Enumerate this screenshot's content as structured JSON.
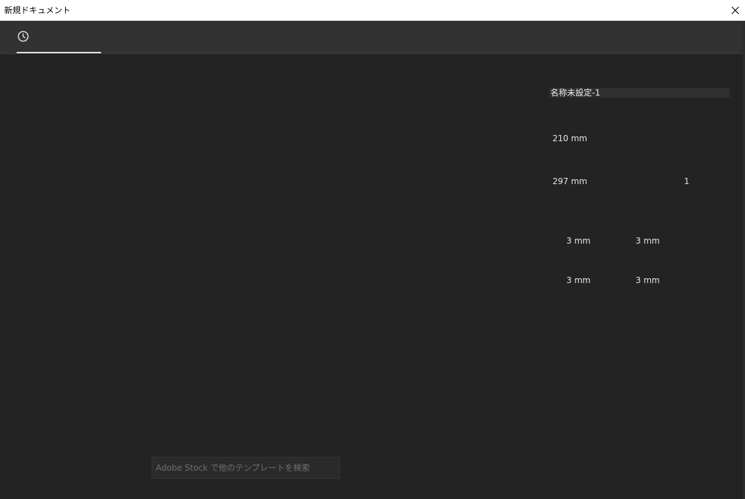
{
  "window": {
    "title": "新規ドキュメント",
    "close_icon": "close-icon"
  },
  "tabs": {
    "recent_icon": "clock-icon",
    "active": "recent"
  },
  "preset": {
    "document_name": "名称未設定-1",
    "width": "210 mm",
    "height": "297 mm",
    "pages": "1",
    "bleed": {
      "top": "3 mm",
      "bottom": "3 mm",
      "inside": "3 mm",
      "outside": "3 mm"
    }
  },
  "search": {
    "placeholder": "Adobe Stock で他のテンプレートを検索"
  },
  "colors": {
    "background": "#232323",
    "tabbar": "#323232",
    "titlebar": "#ffffff",
    "text": "#e6e6e6"
  }
}
